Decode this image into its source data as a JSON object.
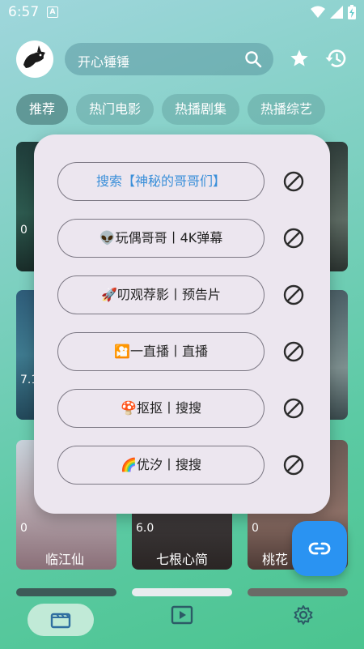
{
  "status_bar": {
    "time": "6:57",
    "icons": [
      "notification-a-icon",
      "wifi-icon",
      "signal-icon",
      "battery-icon"
    ]
  },
  "header": {
    "search_text": "开心锤锤",
    "icons": [
      "search-icon",
      "star-icon",
      "history-icon"
    ]
  },
  "tabs": [
    {
      "label": "推荐",
      "active": true
    },
    {
      "label": "热门电影",
      "active": false
    },
    {
      "label": "热播剧集",
      "active": false
    },
    {
      "label": "热播综艺",
      "active": false
    }
  ],
  "posters": {
    "row1": [
      {
        "score": "0",
        "title": ""
      },
      {
        "score": "",
        "title": ""
      },
      {
        "score": "",
        "title": ""
      }
    ],
    "row2": [
      {
        "score": "7.1",
        "title": ""
      },
      {
        "score": "",
        "title": ""
      },
      {
        "score": "",
        "title": ""
      }
    ],
    "row3": [
      {
        "score": "0",
        "title": "临江仙"
      },
      {
        "score": "6.0",
        "title": "七根心简"
      },
      {
        "score": "0",
        "title": "桃花"
      }
    ]
  },
  "source_dialog": {
    "sources": [
      {
        "label": "搜索【神秘的哥哥们】",
        "selected": true
      },
      {
        "label": "👽玩偶哥哥丨4K弹幕",
        "selected": false
      },
      {
        "label": "🚀叨观荐影丨预告片",
        "selected": false
      },
      {
        "label": "🎦一直播丨直播",
        "selected": false
      },
      {
        "label": "🍄抠抠丨搜搜",
        "selected": false
      },
      {
        "label": "🌈优汐丨搜搜",
        "selected": false
      }
    ]
  },
  "fab": {
    "icon": "link-icon"
  },
  "bottom_nav": {
    "items": [
      {
        "icon": "film-icon",
        "active": true
      },
      {
        "icon": "play-icon",
        "active": false
      },
      {
        "icon": "settings-icon",
        "active": false
      }
    ]
  },
  "colors": {
    "accent": "#2a93f2",
    "dialog_bg": "#ece6ef",
    "selected_text": "#3a8fd9"
  }
}
